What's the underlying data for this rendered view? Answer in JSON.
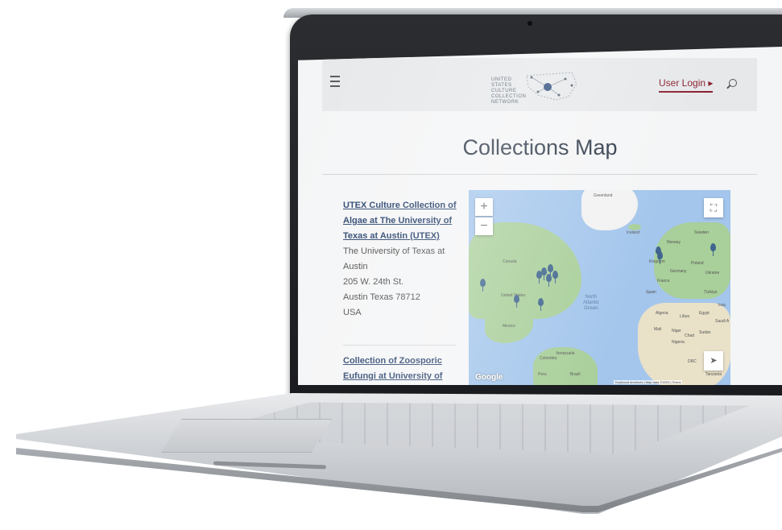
{
  "header": {
    "logo_lines": [
      "UNITED",
      "STATES",
      "CULTURE",
      "COLLECTION",
      "NETWORK"
    ],
    "login_label": "User Login ▸"
  },
  "page": {
    "title": "Collections Map"
  },
  "collections": [
    {
      "name_lines": [
        "UTEX Culture Collection of",
        "Algae at The University of",
        "Texas at Austin (UTEX)"
      ],
      "address_lines": [
        "The University of Texas at",
        "Austin",
        "205 W. 24th St.",
        "Austin Texas 78712",
        "USA"
      ]
    },
    {
      "name_lines": [
        "Collection of Zoosporic",
        "Eufungi at University of"
      ],
      "address_lines": []
    }
  ],
  "map": {
    "zoom_in": "+",
    "zoom_out": "−",
    "fullscreen": "⛶",
    "locate": "➤",
    "labels": {
      "greenland": "Greenland",
      "canada": "Canada",
      "united_states": "United States",
      "mexico": "Mexico",
      "iceland": "Iceland",
      "norway": "Norway",
      "sweden": "Sweden",
      "kingdom": "Kingdom",
      "poland": "Poland",
      "germany": "Germany",
      "ukraine": "Ukraine",
      "france": "France",
      "spain": "Spain",
      "turkiye": "Türkiye",
      "iraq": "Iraq",
      "algeria": "Algeria",
      "libya": "Libya",
      "egypt": "Egypt",
      "saudi": "Saudi A",
      "mali": "Mali",
      "niger": "Niger",
      "chad": "Chad",
      "sudan": "Sudan",
      "nigeria": "Nigeria",
      "venezuela": "Venezuela",
      "colombia": "Colombia",
      "peru": "Peru",
      "brazil": "Brazil",
      "drc": "DRC",
      "tanzania": "Tanzania"
    },
    "ocean_lines": [
      "North",
      "Atlantic",
      "Ocean"
    ],
    "google_label": "Google",
    "attribution": "Keyboard shortcuts  |  Map data ©2023  |  Terms"
  },
  "colors": {
    "accent": "#8b2130",
    "link": "#1f3a66",
    "title": "#2c3848",
    "pin": "#40658e",
    "water": "#a4c6ec",
    "land": "#a9cf9a"
  }
}
